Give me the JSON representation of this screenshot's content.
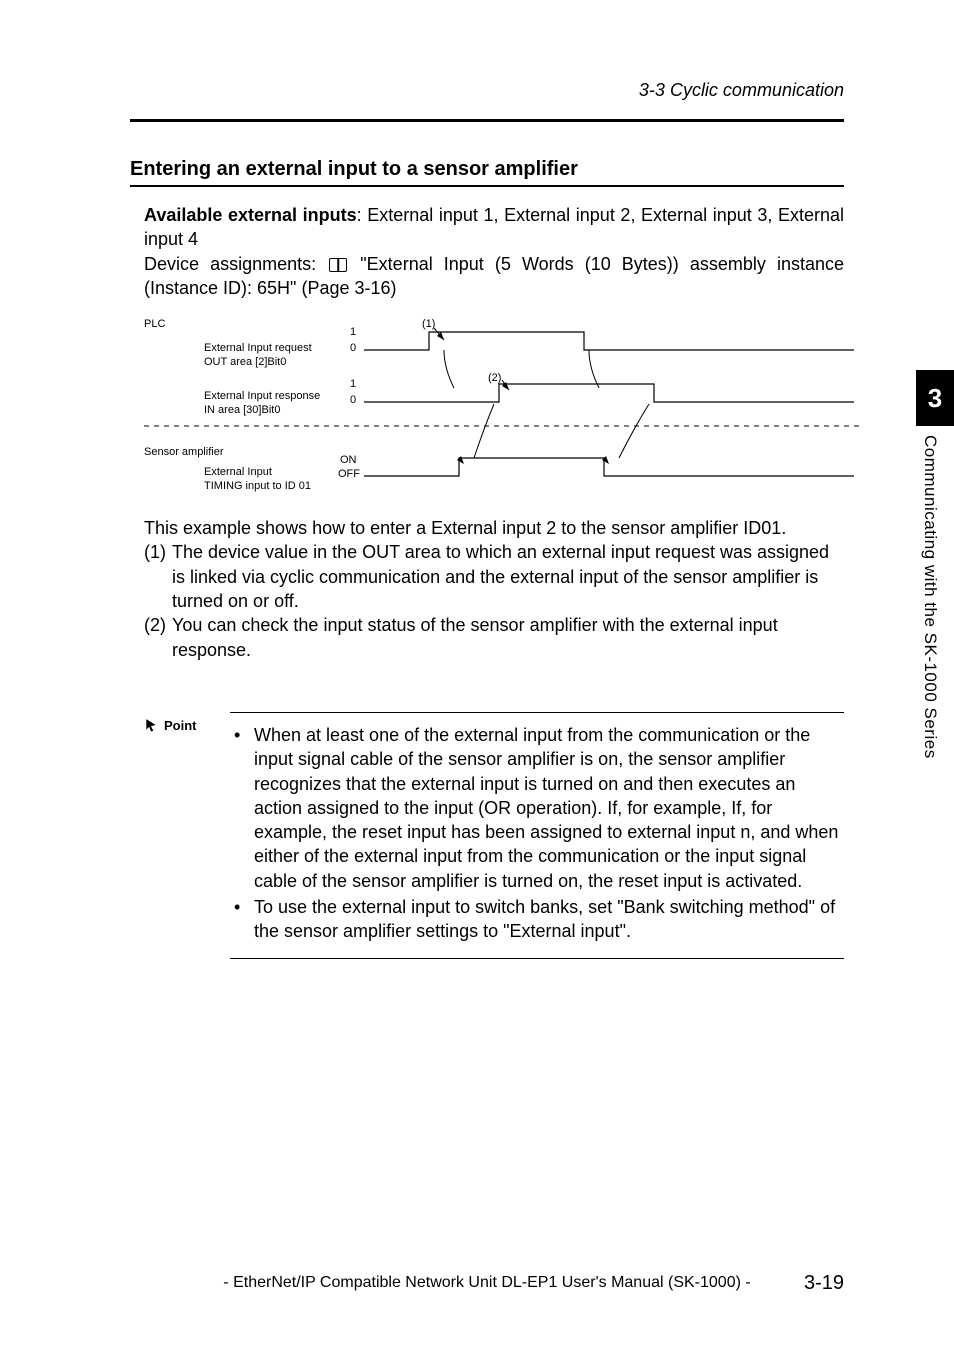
{
  "header": {
    "breadcrumb": "3-3 Cyclic communication"
  },
  "section": {
    "heading": "Entering an external input to a sensor amplifier",
    "intro_bold": "Available external inputs",
    "intro_rest": ": External input 1, External input 2, External input 3, External input 4",
    "device_prefix": "Device assignments: ",
    "device_rest": " \"External Input (5 Words (10 Bytes)) assembly instance (Instance ID): 65H\" (Page 3-16)"
  },
  "diagram": {
    "plc_label": "PLC",
    "sig1_line1": "External Input request",
    "sig1_line2": "OUT area [2]Bit0",
    "sig1_high": "1",
    "sig1_low": "0",
    "marker1": "(1)",
    "sig2_line1": "External Input response",
    "sig2_line2": "IN area [30]Bit0",
    "sig2_high": "1",
    "sig2_low": "0",
    "marker2": "(2)",
    "sensor_label": "Sensor amplifier",
    "sig3_line1": "External Input",
    "sig3_line2": "TIMING input to ID 01",
    "sig3_on": "ON",
    "sig3_off": "OFF"
  },
  "example": {
    "intro": "This example shows how to enter a External input 2 to the sensor amplifier ID01.",
    "item1_num": "(1)",
    "item1_text": "The device value in the OUT area to which an external input request was assigned is linked via cyclic communication and the external input of the sensor amplifier is turned on or off.",
    "item2_num": "(2)",
    "item2_text": "You can check the input status of the sensor amplifier with the external input response."
  },
  "point": {
    "label": "Point",
    "bullet1": " When at least one of the external input from the communication or the input signal cable of the sensor amplifier is on, the sensor amplifier recognizes that the external input is turned on and then executes an action assigned to the input (OR operation). If, for example, If, for example, the reset input has been assigned to external input n, and when either of the external input from the communication or the input signal cable of the sensor amplifier is turned on, the reset input is activated.",
    "bullet2": "To use the external input to switch banks, set \"Bank switching method\" of the sensor amplifier settings to \"External input\"."
  },
  "sidebar": {
    "chapter": "3",
    "title": "Communicating with the SK-1000 Series"
  },
  "footer": {
    "title": "- EtherNet/IP Compatible Network Unit DL-EP1 User's Manual (SK-1000) -",
    "page": "3-19"
  }
}
